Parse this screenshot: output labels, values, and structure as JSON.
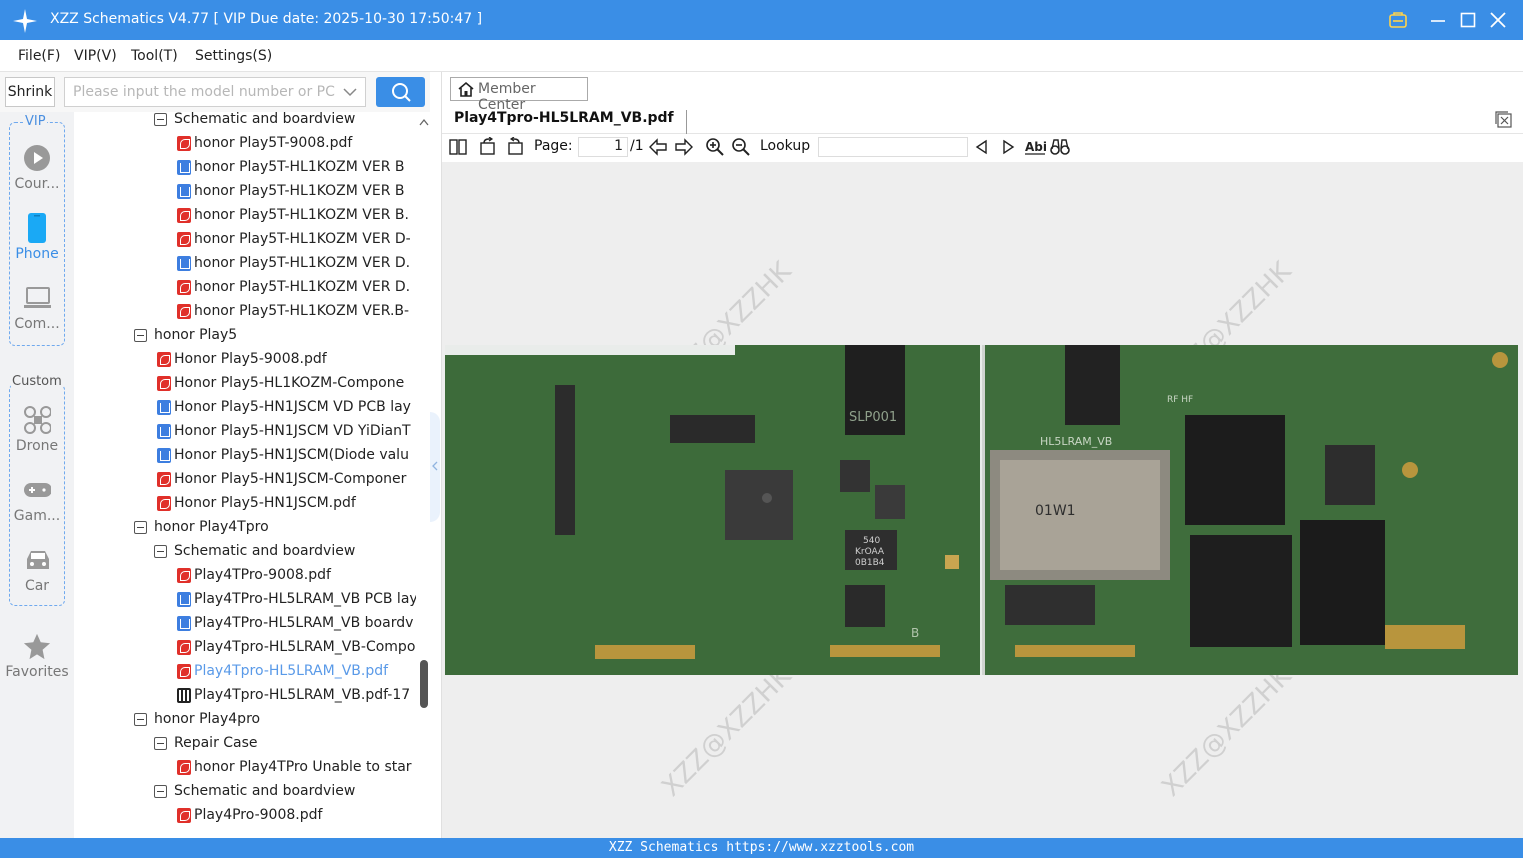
{
  "window": {
    "title": "XZZ Schematics V4.77 [ VIP Due date: 2025-10-30 17:50:47 ]"
  },
  "menu": [
    "File(F)",
    "VIP(V)",
    "Tool(T)",
    "Settings(S)"
  ],
  "search": {
    "shrink_label": "Shrink",
    "placeholder": "Please input the model number or PCB"
  },
  "sidebar": {
    "vip_label": "VIP",
    "custom_label": "Custom",
    "vip_items": [
      {
        "label": "Cour...",
        "icon": "play-circle-icon",
        "active": false
      },
      {
        "label": "Phone",
        "icon": "phone-icon",
        "active": true
      },
      {
        "label": "Com...",
        "icon": "laptop-icon",
        "active": false
      }
    ],
    "custom_items": [
      {
        "label": "Drone",
        "icon": "drone-icon"
      },
      {
        "label": "Gam...",
        "icon": "gamepad-icon"
      },
      {
        "label": "Car",
        "icon": "car-icon"
      }
    ],
    "favorites_label": "Favorites"
  },
  "tree": [
    {
      "level": 2,
      "type": "folder",
      "label": "Schematic and boardview"
    },
    {
      "level": 3,
      "type": "pdf",
      "label": "honor Play5T-9008.pdf"
    },
    {
      "level": 3,
      "type": "pcb",
      "label": "honor Play5T-HL1KOZM VER B"
    },
    {
      "level": 3,
      "type": "pcb",
      "label": "honor Play5T-HL1KOZM VER B"
    },
    {
      "level": 3,
      "type": "pdf",
      "label": "honor Play5T-HL1KOZM VER B."
    },
    {
      "level": 3,
      "type": "pdf",
      "label": "honor Play5T-HL1KOZM VER D-"
    },
    {
      "level": 3,
      "type": "pcb",
      "label": "honor Play5T-HL1KOZM VER D."
    },
    {
      "level": 3,
      "type": "pdf",
      "label": "honor Play5T-HL1KOZM VER D."
    },
    {
      "level": 3,
      "type": "pdf",
      "label": "honor Play5T-HL1KOZM VER.B-"
    },
    {
      "level": 1,
      "type": "folder",
      "label": "honor Play5"
    },
    {
      "level": 2,
      "type": "pdf",
      "label": "Honor Play5-9008.pdf"
    },
    {
      "level": 2,
      "type": "pdf",
      "label": "Honor Play5-HL1KOZM-Compone"
    },
    {
      "level": 2,
      "type": "pcb",
      "label": "Honor Play5-HN1JSCM VD PCB lay"
    },
    {
      "level": 2,
      "type": "pcb",
      "label": "Honor Play5-HN1JSCM VD YiDianT"
    },
    {
      "level": 2,
      "type": "pcb",
      "label": "Honor Play5-HN1JSCM(Diode valu"
    },
    {
      "level": 2,
      "type": "pdf",
      "label": "Honor Play5-HN1JSCM-Componer"
    },
    {
      "level": 2,
      "type": "pdf",
      "label": "Honor Play5-HN1JSCM.pdf"
    },
    {
      "level": 1,
      "type": "folder",
      "label": "honor Play4Tpro"
    },
    {
      "level": 2,
      "type": "folder",
      "label": "Schematic and boardview"
    },
    {
      "level": 3,
      "type": "pdf",
      "label": "Play4TPro-9008.pdf"
    },
    {
      "level": 3,
      "type": "pcb",
      "label": "Play4TPro-HL5LRAM_VB PCB lay"
    },
    {
      "level": 3,
      "type": "pcb",
      "label": "Play4TPro-HL5LRAM_VB boardv"
    },
    {
      "level": 3,
      "type": "pdf",
      "label": "Play4Tpro-HL5LRAM_VB-Compo"
    },
    {
      "level": 3,
      "type": "pdf",
      "label": "Play4Tpro-HL5LRAM_VB.pdf",
      "selected": true
    },
    {
      "level": 3,
      "type": "img",
      "label": "Play4Tpro-HL5LRAM_VB.pdf-17"
    },
    {
      "level": 1,
      "type": "folder",
      "label": "honor Play4pro"
    },
    {
      "level": 2,
      "type": "folder",
      "label": "Repair Case"
    },
    {
      "level": 3,
      "type": "pdf",
      "label": "honor Play4TPro Unable to star"
    },
    {
      "level": 2,
      "type": "folder",
      "label": "Schematic and boardview"
    },
    {
      "level": 3,
      "type": "pdf",
      "label": "Play4Pro-9008.pdf"
    }
  ],
  "main": {
    "member_center": "Member Center",
    "tab_title": "Play4Tpro-HL5LRAM_VB.pdf",
    "page_label": "Page:",
    "page_value": "1",
    "page_total": "/1",
    "lookup_label": "Lookup",
    "watermark": "XZZ@XZZHK",
    "board_silkscreen": {
      "left_chip": "SLP001",
      "board_name": "HL5LRAM_VB",
      "chip_a": "540",
      "chip_b": "KrOAA",
      "chip_c": "0B1B4",
      "cover": "01W1",
      "mark_b": "B",
      "mark_rf": "RF HF"
    }
  },
  "statusbar": {
    "text": "XZZ Schematics https://www.xzztools.com"
  },
  "colors": {
    "accent": "#3a8ee6",
    "selected_text": "#5a9ae8",
    "pcb_green": "#3d6b3a"
  }
}
